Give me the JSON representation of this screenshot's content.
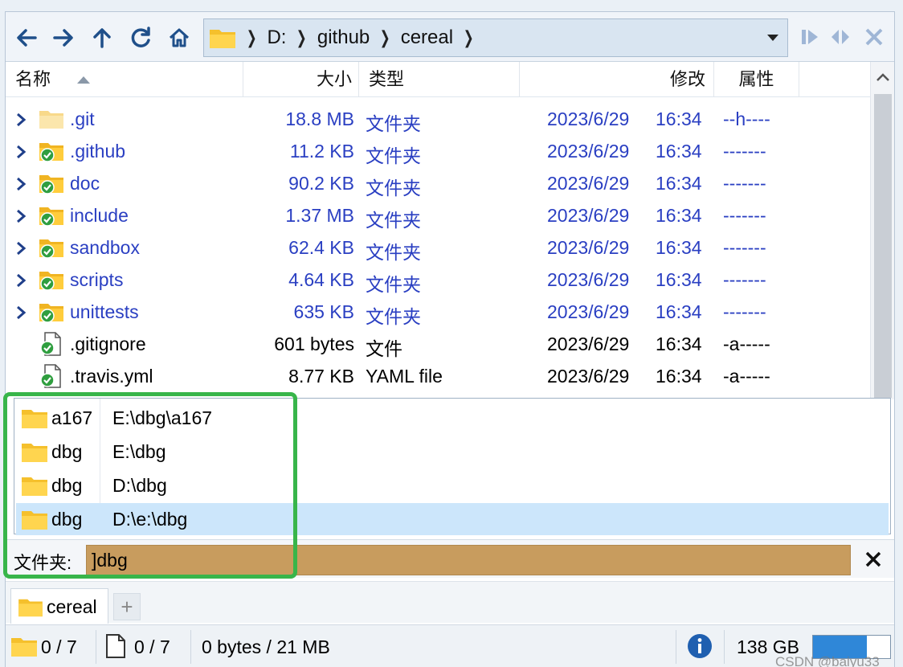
{
  "toolbar": {
    "breadcrumbs": [
      "D:",
      "github",
      "cereal"
    ]
  },
  "columns": {
    "name": "名称",
    "size": "大小",
    "type": "类型",
    "modified": "修改",
    "attributes": "属性"
  },
  "files": [
    {
      "name": ".git",
      "size": "18.8 MB",
      "type": "文件夹",
      "date": "2023/6/29",
      "time": "16:34",
      "attr": "--h----",
      "kind": "folder",
      "git": false
    },
    {
      "name": ".github",
      "size": "11.2 KB",
      "type": "文件夹",
      "date": "2023/6/29",
      "time": "16:34",
      "attr": "-------",
      "kind": "folder",
      "git": true
    },
    {
      "name": "doc",
      "size": "90.2 KB",
      "type": "文件夹",
      "date": "2023/6/29",
      "time": "16:34",
      "attr": "-------",
      "kind": "folder",
      "git": true
    },
    {
      "name": "include",
      "size": "1.37 MB",
      "type": "文件夹",
      "date": "2023/6/29",
      "time": "16:34",
      "attr": "-------",
      "kind": "folder",
      "git": true
    },
    {
      "name": "sandbox",
      "size": "62.4 KB",
      "type": "文件夹",
      "date": "2023/6/29",
      "time": "16:34",
      "attr": "-------",
      "kind": "folder",
      "git": true
    },
    {
      "name": "scripts",
      "size": "4.64 KB",
      "type": "文件夹",
      "date": "2023/6/29",
      "time": "16:34",
      "attr": "-------",
      "kind": "folder",
      "git": true
    },
    {
      "name": "unittests",
      "size": "635 KB",
      "type": "文件夹",
      "date": "2023/6/29",
      "time": "16:34",
      "attr": "-------",
      "kind": "folder",
      "git": true
    },
    {
      "name": ".gitignore",
      "size": "601 bytes",
      "type": "文件",
      "date": "2023/6/29",
      "time": "16:34",
      "attr": "-a-----",
      "kind": "file",
      "git": true
    },
    {
      "name": ".travis.yml",
      "size": "8.77 KB",
      "type": "YAML file",
      "date": "2023/6/29",
      "time": "16:34",
      "attr": "-a-----",
      "kind": "file",
      "git": true
    }
  ],
  "popup": [
    {
      "name": "a167",
      "path": "E:\\dbg\\a167",
      "selected": false
    },
    {
      "name": "dbg",
      "path": "E:\\dbg",
      "selected": false
    },
    {
      "name": "dbg",
      "path": "D:\\dbg",
      "selected": false
    },
    {
      "name": "dbg",
      "path": "D:\\e:\\dbg",
      "selected": true
    }
  ],
  "filter": {
    "label": "文件夹:",
    "value": "]dbg"
  },
  "tabs": [
    {
      "label": "cereal"
    }
  ],
  "tab_add_label": "+",
  "status": {
    "folders": "0 / 7",
    "files": "0 / 7",
    "size": "0 bytes / 21 MB",
    "free": "138 GB",
    "disk_used_fraction": 0.7
  },
  "watermark": "CSDN @baiyu33",
  "colors": {
    "folder": "#f5c02c",
    "link_blue": "#2a3fc2",
    "filter_bg": "#c89c5e",
    "selection": "#cce6fb",
    "highlight_box": "#38b54a"
  }
}
